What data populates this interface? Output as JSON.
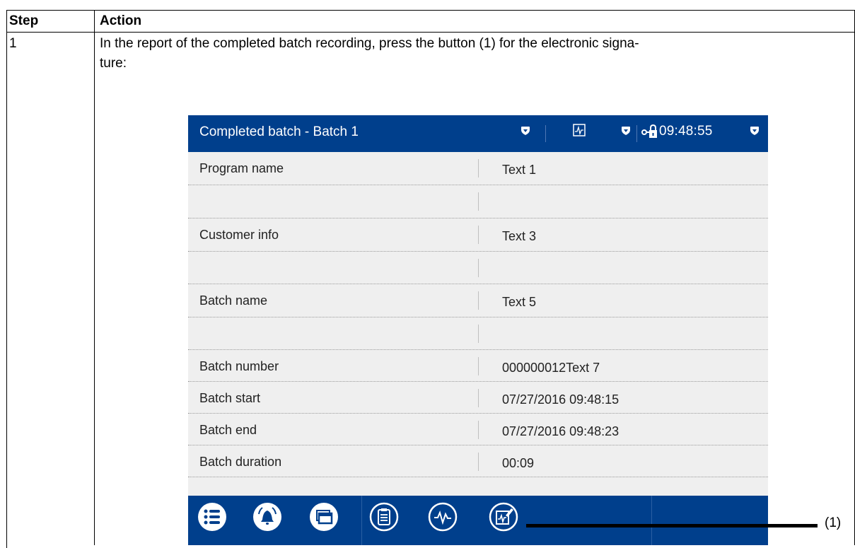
{
  "table": {
    "header_step": "Step",
    "header_action": "Action",
    "step_number": "1",
    "instruction": "In the report of the completed batch recording, press the button (1) for the electronic signa-\nture:"
  },
  "screen": {
    "title": "Completed batch - Batch 1",
    "clock": "09:48:55",
    "rows": [
      {
        "label": "Program name",
        "value": "Text 1"
      },
      {
        "label": "",
        "value": ""
      },
      {
        "label": "Customer info",
        "value": "Text 3"
      },
      {
        "label": "",
        "value": ""
      },
      {
        "label": "Batch name",
        "value": "Text 5"
      },
      {
        "label": "",
        "value": ""
      },
      {
        "label": "Batch number",
        "value": "000000012Text 7"
      },
      {
        "label": "Batch start",
        "value": "07/27/2016 09:48:15"
      },
      {
        "label": "Batch end",
        "value": "07/27/2016 09:48:23"
      },
      {
        "label": "Batch duration",
        "value": "00:09"
      }
    ],
    "toolbar_icons": [
      "menu-list-icon",
      "alarm-bell-icon",
      "windows-icon",
      "clipboard-icon",
      "signal-curve-icon",
      "signature-icon"
    ],
    "accent_color": "#003f8c"
  },
  "callout": {
    "label": "(1)"
  }
}
